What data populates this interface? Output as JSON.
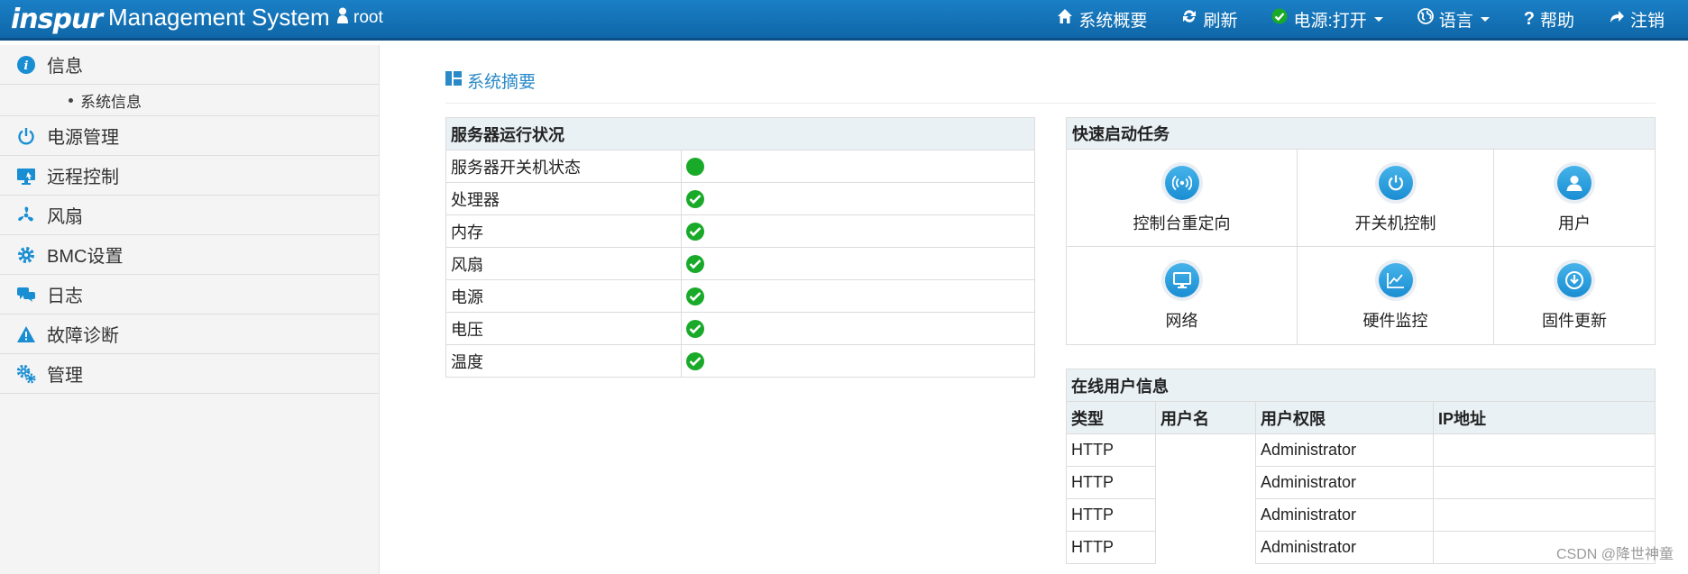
{
  "header": {
    "logo": "inspur",
    "title": "Management System",
    "user": "root",
    "nav": [
      {
        "label": "系统概要",
        "icon": "home-icon"
      },
      {
        "label": "刷新",
        "icon": "refresh-icon"
      },
      {
        "label": "电源:打开",
        "icon": "check-icon",
        "dropdown": true
      },
      {
        "label": "语言",
        "icon": "globe-icon",
        "dropdown": true
      },
      {
        "label": "帮助",
        "icon": "help-icon"
      },
      {
        "label": "注销",
        "icon": "logout-icon"
      }
    ]
  },
  "sidebar": {
    "items": [
      {
        "label": "信息",
        "icon": "info-icon"
      },
      {
        "label": "电源管理",
        "icon": "power-icon"
      },
      {
        "label": "远程控制",
        "icon": "monitor-icon"
      },
      {
        "label": "风扇",
        "icon": "fan-icon"
      },
      {
        "label": "BMC设置",
        "icon": "gear-icon"
      },
      {
        "label": "日志",
        "icon": "chat-icon"
      },
      {
        "label": "故障诊断",
        "icon": "warning-icon"
      },
      {
        "label": "管理",
        "icon": "gears-icon"
      }
    ],
    "subitem": "系统信息"
  },
  "main": {
    "page_title": "系统摘要",
    "status": {
      "title": "服务器运行状况",
      "rows": [
        {
          "label": "服务器开关机状态",
          "state": "on"
        },
        {
          "label": "处理器",
          "state": "ok"
        },
        {
          "label": "内存",
          "state": "ok"
        },
        {
          "label": "风扇",
          "state": "ok"
        },
        {
          "label": "电源",
          "state": "ok"
        },
        {
          "label": "电压",
          "state": "ok"
        },
        {
          "label": "温度",
          "state": "ok"
        }
      ]
    },
    "quick_tasks": {
      "title": "快速启动任务",
      "items": [
        {
          "label": "控制台重定向",
          "icon": "broadcast-icon"
        },
        {
          "label": "开关机控制",
          "icon": "power-icon"
        },
        {
          "label": "用户",
          "icon": "user-icon"
        },
        {
          "label": "网络",
          "icon": "monitor-icon"
        },
        {
          "label": "硬件监控",
          "icon": "chart-icon"
        },
        {
          "label": "固件更新",
          "icon": "download-icon"
        }
      ]
    },
    "online_users": {
      "title": "在线用户信息",
      "columns": [
        "类型",
        "用户名",
        "用户权限",
        "IP地址"
      ],
      "rows": [
        {
          "type": "HTTP",
          "username": "",
          "privilege": "Administrator",
          "ip": ""
        },
        {
          "type": "HTTP",
          "username": "",
          "privilege": "Administrator",
          "ip": ""
        },
        {
          "type": "HTTP",
          "username": "",
          "privilege": "Administrator",
          "ip": ""
        },
        {
          "type": "HTTP",
          "username": "",
          "privilege": "Administrator",
          "ip": ""
        }
      ]
    }
  },
  "watermark": "CSDN @降世神童",
  "colors": {
    "header": "#1478be",
    "accent": "#2a8ac8",
    "ok": "#1aaa2a"
  }
}
